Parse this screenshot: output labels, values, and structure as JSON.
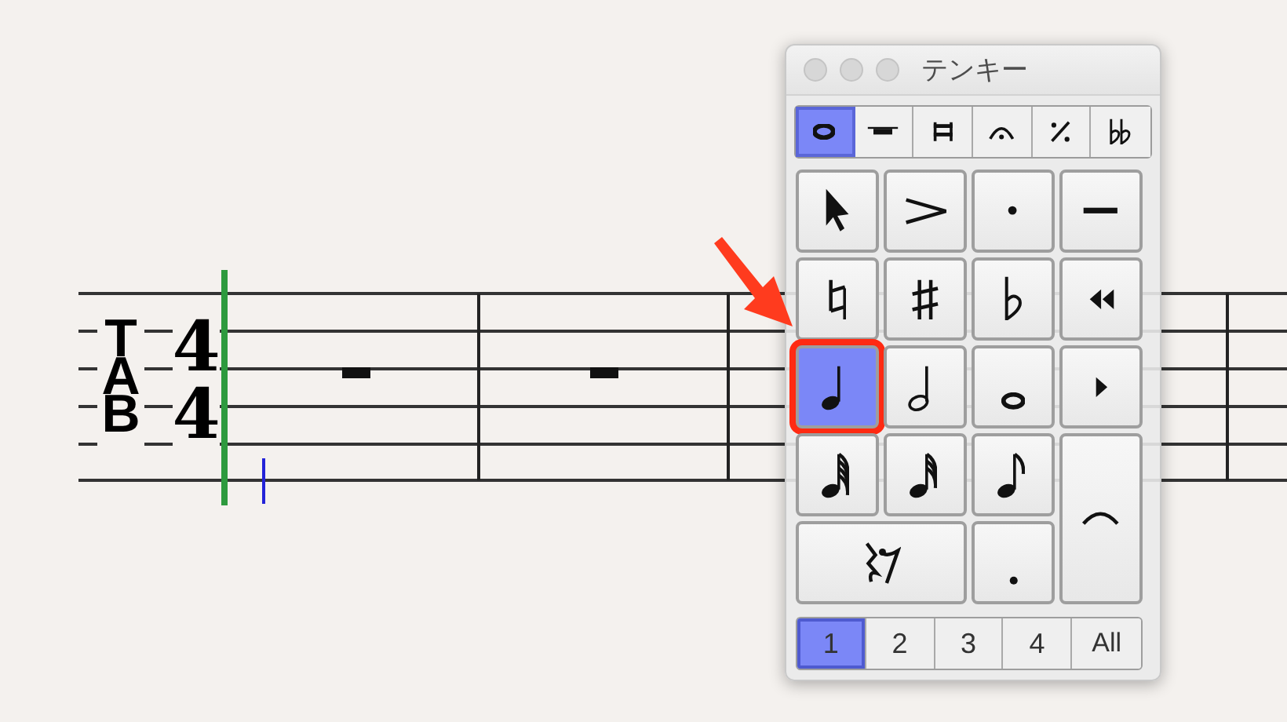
{
  "score": {
    "clef": [
      "T",
      "A",
      "B"
    ],
    "time_signature": [
      "4",
      "4"
    ],
    "measures": [
      {
        "kind": "rest"
      },
      {
        "kind": "rest"
      },
      {
        "kind": "empty"
      },
      {
        "kind": "empty"
      }
    ]
  },
  "palette": {
    "title": "テンキー",
    "tabs": [
      {
        "kind": "notehead",
        "selected": true
      },
      {
        "kind": "half-rest",
        "selected": false
      },
      {
        "kind": "double-bar",
        "selected": false
      },
      {
        "kind": "fermata",
        "selected": false
      },
      {
        "kind": "repeat",
        "selected": false
      },
      {
        "kind": "double-flat",
        "selected": false
      }
    ],
    "keys": [
      {
        "kind": "pointer",
        "selected": false,
        "highlighted": false
      },
      {
        "kind": "accent",
        "selected": false,
        "highlighted": false
      },
      {
        "kind": "staccato",
        "selected": false,
        "highlighted": false
      },
      {
        "kind": "tenuto",
        "selected": false,
        "highlighted": false
      },
      {
        "kind": "natural",
        "selected": false,
        "highlighted": false
      },
      {
        "kind": "sharp",
        "selected": false,
        "highlighted": false
      },
      {
        "kind": "flat",
        "selected": false,
        "highlighted": false
      },
      {
        "kind": "rewind",
        "selected": false,
        "highlighted": false
      },
      {
        "kind": "quarter",
        "selected": true,
        "highlighted": true
      },
      {
        "kind": "half",
        "selected": false,
        "highlighted": false
      },
      {
        "kind": "whole",
        "selected": false,
        "highlighted": false
      },
      {
        "kind": "play",
        "selected": false,
        "highlighted": false
      },
      {
        "kind": "sixtyfourth",
        "selected": false,
        "highlighted": false
      },
      {
        "kind": "thirtysecond",
        "selected": false,
        "highlighted": false
      },
      {
        "kind": "eighth",
        "selected": false,
        "highlighted": false
      },
      {
        "kind": "tie",
        "selected": false,
        "highlighted": false
      },
      {
        "kind": "rests",
        "selected": false,
        "highlighted": false
      },
      {
        "kind": "dot",
        "selected": false,
        "highlighted": false
      }
    ],
    "voices": [
      {
        "label": "1",
        "selected": true
      },
      {
        "label": "2",
        "selected": false
      },
      {
        "label": "3",
        "selected": false
      },
      {
        "label": "4",
        "selected": false
      },
      {
        "label": "All",
        "selected": false
      }
    ]
  },
  "annotation": {
    "kind": "arrow"
  }
}
